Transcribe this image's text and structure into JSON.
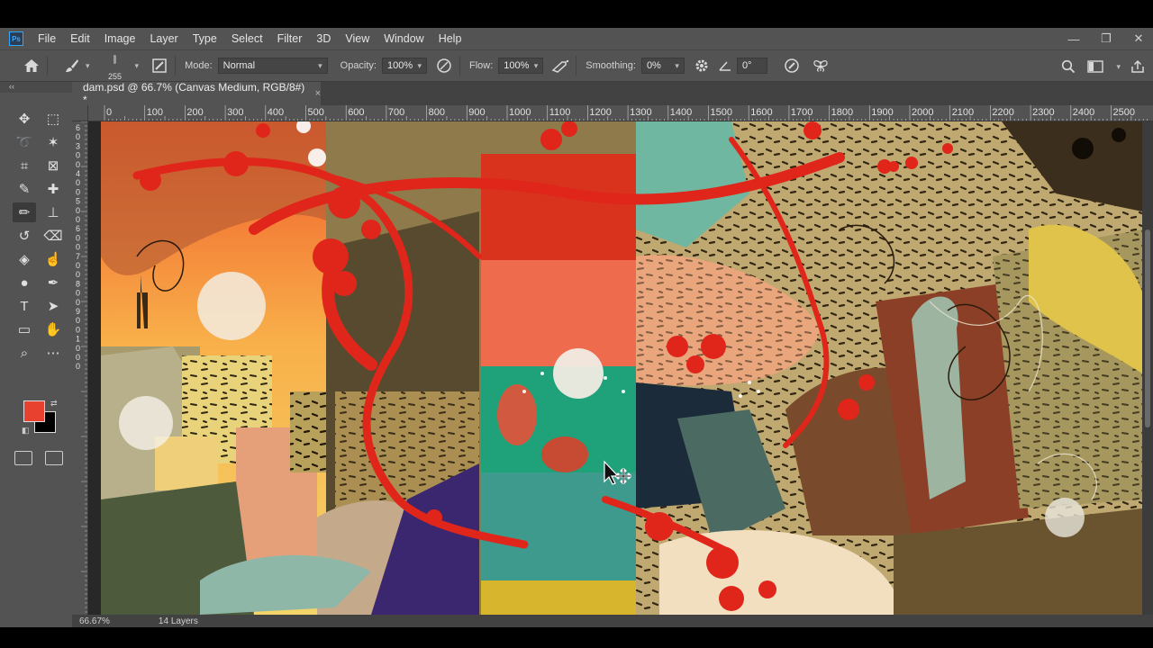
{
  "app": {
    "logo": "Ps"
  },
  "menu": [
    "File",
    "Edit",
    "Image",
    "Layer",
    "Type",
    "Select",
    "Filter",
    "3D",
    "View",
    "Window",
    "Help"
  ],
  "window_controls": {
    "minimize": "—",
    "restore": "❐",
    "close": "✕"
  },
  "options": {
    "brush_size": "255",
    "mode_label": "Mode:",
    "mode_value": "Normal",
    "opacity_label": "Opacity:",
    "opacity_value": "100%",
    "flow_label": "Flow:",
    "flow_value": "100%",
    "smoothing_label": "Smoothing:",
    "smoothing_value": "0%",
    "angle_value": "0°"
  },
  "collapse_glyph": "‹‹",
  "document": {
    "tab_title": "dam.psd @ 66.7% (Canvas Medium, RGB/8#) *",
    "close_glyph": "×"
  },
  "ruler": {
    "h_labels": [
      "0",
      "100",
      "200",
      "300",
      "400",
      "500",
      "600",
      "700",
      "800",
      "900",
      "1000",
      "1100",
      "1200",
      "1300",
      "1400",
      "1500",
      "1600",
      "1700",
      "1800",
      "1900",
      "2000",
      "2100",
      "2200",
      "2300",
      "2400",
      "2500"
    ],
    "v_labels": [
      "6",
      "0",
      "3",
      "0",
      "0",
      "4",
      "0",
      "0",
      "5",
      "0",
      "0",
      "6",
      "0",
      "0",
      "7",
      "0",
      "0",
      "8",
      "0",
      "0",
      "9",
      "0",
      "0",
      "1",
      "0",
      "0",
      "0"
    ]
  },
  "tools": [
    {
      "name": "move-tool",
      "glyph": "✥"
    },
    {
      "name": "marquee-tool",
      "glyph": "⬚"
    },
    {
      "name": "lasso-tool",
      "glyph": "➰"
    },
    {
      "name": "magic-wand-tool",
      "glyph": "✶"
    },
    {
      "name": "crop-tool",
      "glyph": "⌗"
    },
    {
      "name": "frame-tool",
      "glyph": "⊠"
    },
    {
      "name": "eyedropper-tool",
      "glyph": "✎"
    },
    {
      "name": "healing-brush-tool",
      "glyph": "✚"
    },
    {
      "name": "brush-tool",
      "glyph": "✏"
    },
    {
      "name": "clone-stamp-tool",
      "glyph": "⊥"
    },
    {
      "name": "history-brush-tool",
      "glyph": "↺"
    },
    {
      "name": "eraser-tool",
      "glyph": "⌫"
    },
    {
      "name": "paint-bucket-tool",
      "glyph": "◈"
    },
    {
      "name": "smudge-tool",
      "glyph": "☝"
    },
    {
      "name": "dodge-tool",
      "glyph": "●"
    },
    {
      "name": "pen-tool",
      "glyph": "✒"
    },
    {
      "name": "type-tool",
      "glyph": "T"
    },
    {
      "name": "path-selection-tool",
      "glyph": "➤"
    },
    {
      "name": "rectangle-tool",
      "glyph": "▭"
    },
    {
      "name": "hand-tool",
      "glyph": "✋"
    },
    {
      "name": "zoom-tool",
      "glyph": "⌕"
    },
    {
      "name": "more-tools",
      "glyph": "⋯"
    }
  ],
  "colors": {
    "foreground": "#e8412f",
    "background": "#000000",
    "ui_panel": "#535353",
    "accent": "#31a8ff"
  },
  "status": {
    "zoom": "66.67%",
    "layers": "14 Layers"
  }
}
